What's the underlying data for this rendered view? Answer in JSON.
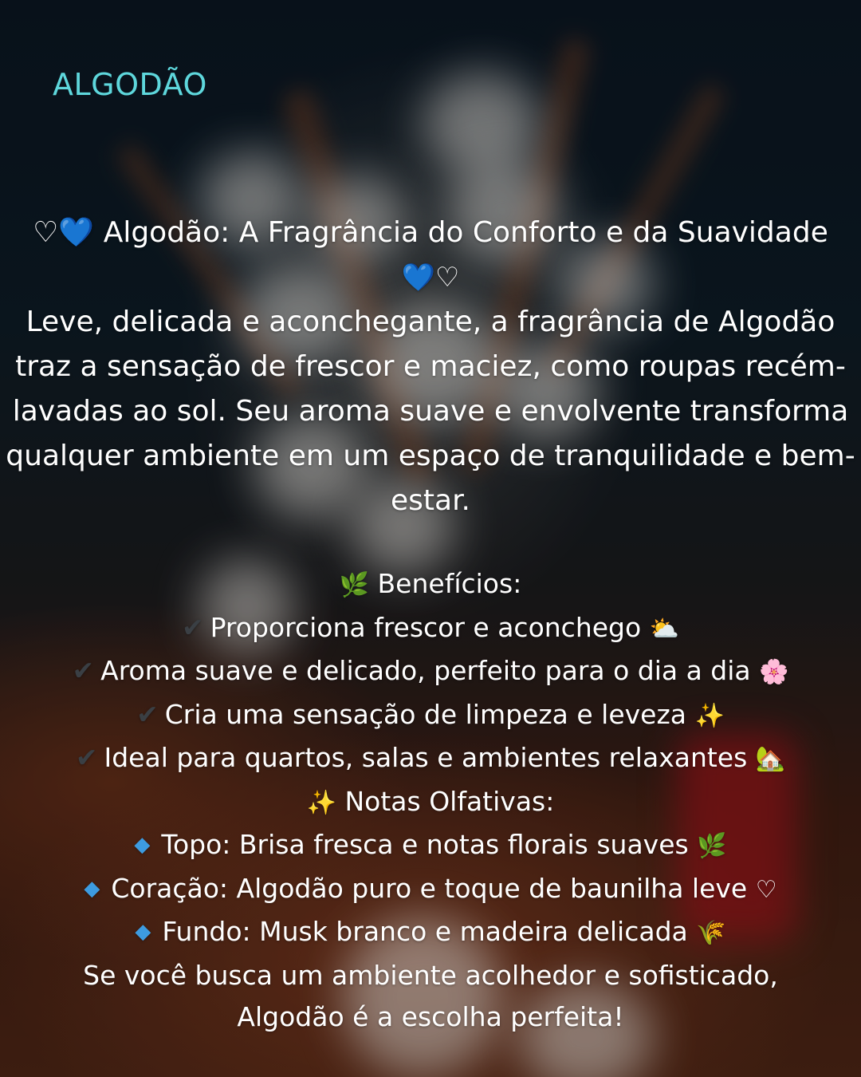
{
  "brand": "ALGODÃO",
  "title": {
    "lead_icons": "♡💙",
    "text": "Algodão: A Fragrância do Conforto e da Suavidade",
    "tail_icons": "💙♡"
  },
  "description": "Leve, delicada e aconchegante, a fragrância de Algodão traz a sensação de frescor e maciez, como roupas recém-lavadas ao sol. Seu aroma suave e envolvente transforma qualquer ambiente em um espaço de tranquilidade e bem-estar.",
  "benefits": {
    "icon": "🌿",
    "heading": "Benefícios:",
    "check_icon": "✔",
    "items": [
      {
        "text": "Proporciona frescor e aconchego",
        "emoji": "⛅"
      },
      {
        "text": "Aroma suave e delicado, perfeito para o dia a dia",
        "emoji": "🌸"
      },
      {
        "text": "Cria uma sensação de limpeza e leveza",
        "emoji": "✨"
      },
      {
        "text": "Ideal para quartos, salas e ambientes relaxantes",
        "emoji": "🏡"
      }
    ]
  },
  "notes": {
    "icon": "✨",
    "heading": "Notas Olfativas:",
    "bullet_icon": "◆",
    "items": [
      {
        "text": "Topo: Brisa fresca e notas florais suaves",
        "emoji": "🌿"
      },
      {
        "text": "Coração: Algodão puro e toque de baunilha leve",
        "emoji": "♡"
      },
      {
        "text": "Fundo: Musk branco e madeira delicada",
        "emoji": "🌾"
      }
    ]
  },
  "closing": {
    "line1": "Se você busca um ambiente acolhedor e sofisticado,",
    "line2": "Algodão é a escolha perfeita!"
  },
  "colors": {
    "brand": "#5ed7dc",
    "text": "#ffffff",
    "bullet": "#3d9be0"
  }
}
